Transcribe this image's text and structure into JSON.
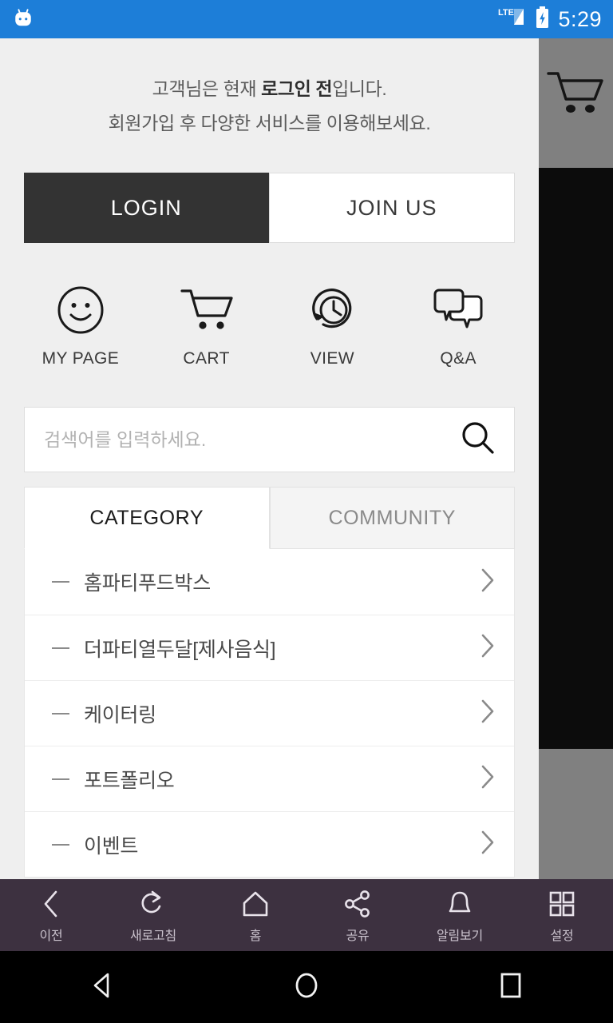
{
  "statusbar": {
    "mascot_icon": "android-mascot-icon",
    "network_label": "LTE",
    "signal_icon": "signal-bars-icon",
    "battery_icon": "battery-charging-icon",
    "time": "5:29"
  },
  "right_panel": {
    "cart_icon": "cart-icon"
  },
  "greeting": {
    "line1_prefix": "고객님은 현재 ",
    "line1_bold": "로그인 전",
    "line1_suffix": "입니다.",
    "line2": "회원가입 후 다양한 서비스를 이용해보세요."
  },
  "auth": {
    "login_label": "LOGIN",
    "join_label": "JOIN US",
    "login_bg": "#333333",
    "join_bg": "#ffffff"
  },
  "quick_menu": [
    {
      "label": "MY PAGE",
      "icon": "smiley-face-icon"
    },
    {
      "label": "CART",
      "icon": "cart-icon"
    },
    {
      "label": "VIEW",
      "icon": "history-clock-icon"
    },
    {
      "label": "Q&A",
      "icon": "chat-bubbles-icon"
    }
  ],
  "search": {
    "value": "",
    "placeholder": "검색어를 입력하세요.",
    "icon": "search-icon"
  },
  "tabs": [
    {
      "label": "CATEGORY",
      "active": true
    },
    {
      "label": "COMMUNITY",
      "active": false
    }
  ],
  "categories": [
    {
      "label": "홈파티푸드박스"
    },
    {
      "label": "더파티열두달[제사음식]"
    },
    {
      "label": "케이터링"
    },
    {
      "label": "포트폴리오"
    },
    {
      "label": "이벤트"
    }
  ],
  "app_toolbar": {
    "bg": "#3d3140",
    "items": [
      {
        "label": "이전",
        "icon": "chevron-left-icon"
      },
      {
        "label": "새로고침",
        "icon": "refresh-icon"
      },
      {
        "label": "홈",
        "icon": "home-icon"
      },
      {
        "label": "공유",
        "icon": "share-icon"
      },
      {
        "label": "알림보기",
        "icon": "bell-icon"
      },
      {
        "label": "설정",
        "icon": "grid-settings-icon"
      }
    ]
  },
  "nav_bar": {
    "items": [
      {
        "icon": "nav-back-icon"
      },
      {
        "icon": "nav-home-icon"
      },
      {
        "icon": "nav-recents-icon"
      }
    ]
  }
}
